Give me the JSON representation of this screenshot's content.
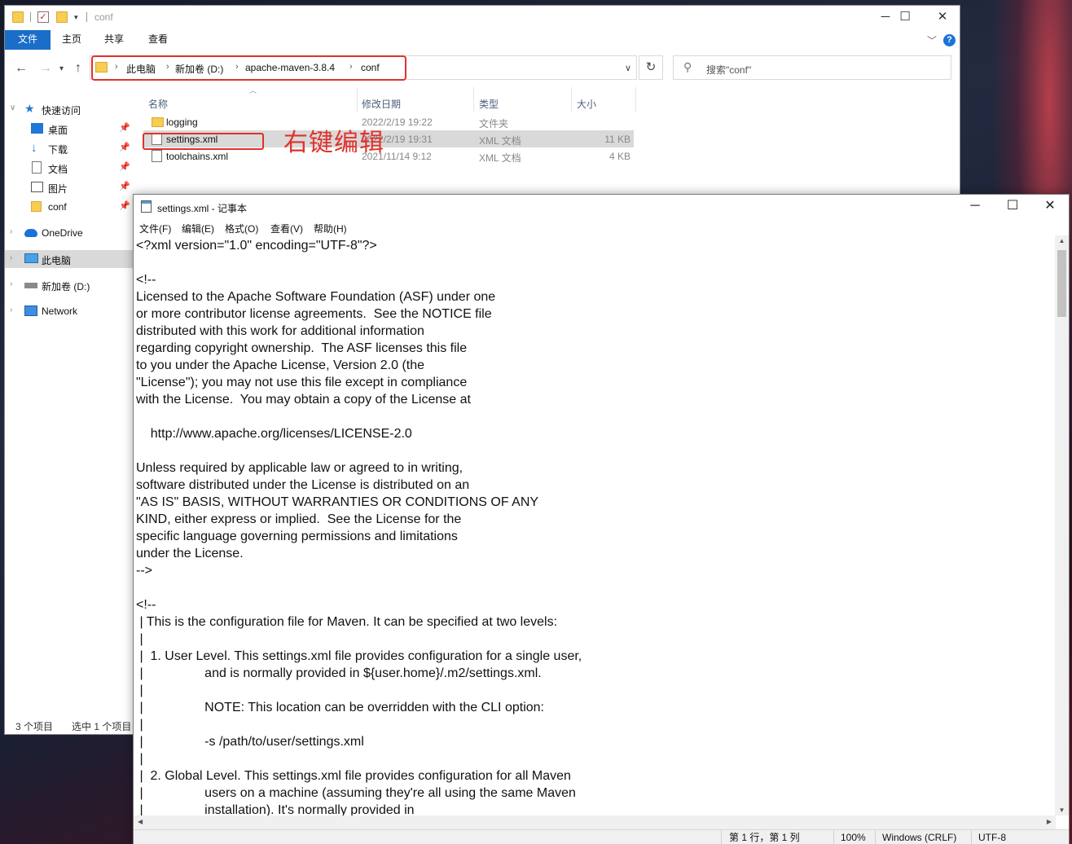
{
  "explorer": {
    "title": "conf",
    "ribbon_tabs": [
      "文件",
      "主页",
      "共享",
      "查看"
    ],
    "breadcrumb": [
      "此电脑",
      "新加卷 (D:)",
      "apache-maven-3.8.4",
      "conf"
    ],
    "search_placeholder": "搜索\"conf\"",
    "columns": [
      "名称",
      "修改日期",
      "类型",
      "大小"
    ],
    "files": [
      {
        "name": "logging",
        "date": "2022/2/19 19:22",
        "type": "文件夹",
        "size": "",
        "icon": "folder-icon"
      },
      {
        "name": "settings.xml",
        "date": "2022/2/19 19:31",
        "type": "XML 文档",
        "size": "11 KB",
        "icon": "xml-file-icon",
        "selected": true
      },
      {
        "name": "toolchains.xml",
        "date": "2021/11/14 9:12",
        "type": "XML 文档",
        "size": "4 KB",
        "icon": "xml-file-icon"
      }
    ],
    "sidebar": {
      "quick_access": "快速访问",
      "items": [
        "桌面",
        "下载",
        "文档",
        "图片",
        "conf"
      ],
      "onedrive": "OneDrive",
      "this_pc": "此电脑",
      "drive": "新加卷 (D:)",
      "network": "Network"
    },
    "status": {
      "count": "3 个项目",
      "selected": "选中 1 个项目"
    },
    "annotation": "右键编辑",
    "annotation_color": "#e0322b"
  },
  "notepad": {
    "title": "settings.xml - 记事本",
    "menu": [
      "文件(F)",
      "编辑(E)",
      "格式(O)",
      "查看(V)",
      "帮助(H)"
    ],
    "content": "<?xml version=\"1.0\" encoding=\"UTF-8\"?>\n\n<!--\nLicensed to the Apache Software Foundation (ASF) under one\nor more contributor license agreements.  See the NOTICE file\ndistributed with this work for additional information\nregarding copyright ownership.  The ASF licenses this file\nto you under the Apache License, Version 2.0 (the\n\"License\"); you may not use this file except in compliance\nwith the License.  You may obtain a copy of the License at\n\n    http://www.apache.org/licenses/LICENSE-2.0\n\nUnless required by applicable law or agreed to in writing,\nsoftware distributed under the License is distributed on an\n\"AS IS\" BASIS, WITHOUT WARRANTIES OR CONDITIONS OF ANY\nKIND, either express or implied.  See the License for the\nspecific language governing permissions and limitations\nunder the License.\n-->\n\n<!--\n | This is the configuration file for Maven. It can be specified at two levels:\n |\n |  1. User Level. This settings.xml file provides configuration for a single user,\n |                 and is normally provided in ${user.home}/.m2/settings.xml.\n |\n |                 NOTE: This location can be overridden with the CLI option:\n |\n |                 -s /path/to/user/settings.xml\n |\n |  2. Global Level. This settings.xml file provides configuration for all Maven\n |                 users on a machine (assuming they're all using the same Maven\n |                 installation). It's normally provided in",
    "status": {
      "position": "第 1 行，第 1 列",
      "zoom": "100%",
      "line_ending": "Windows (CRLF)",
      "encoding": "UTF-8"
    }
  }
}
